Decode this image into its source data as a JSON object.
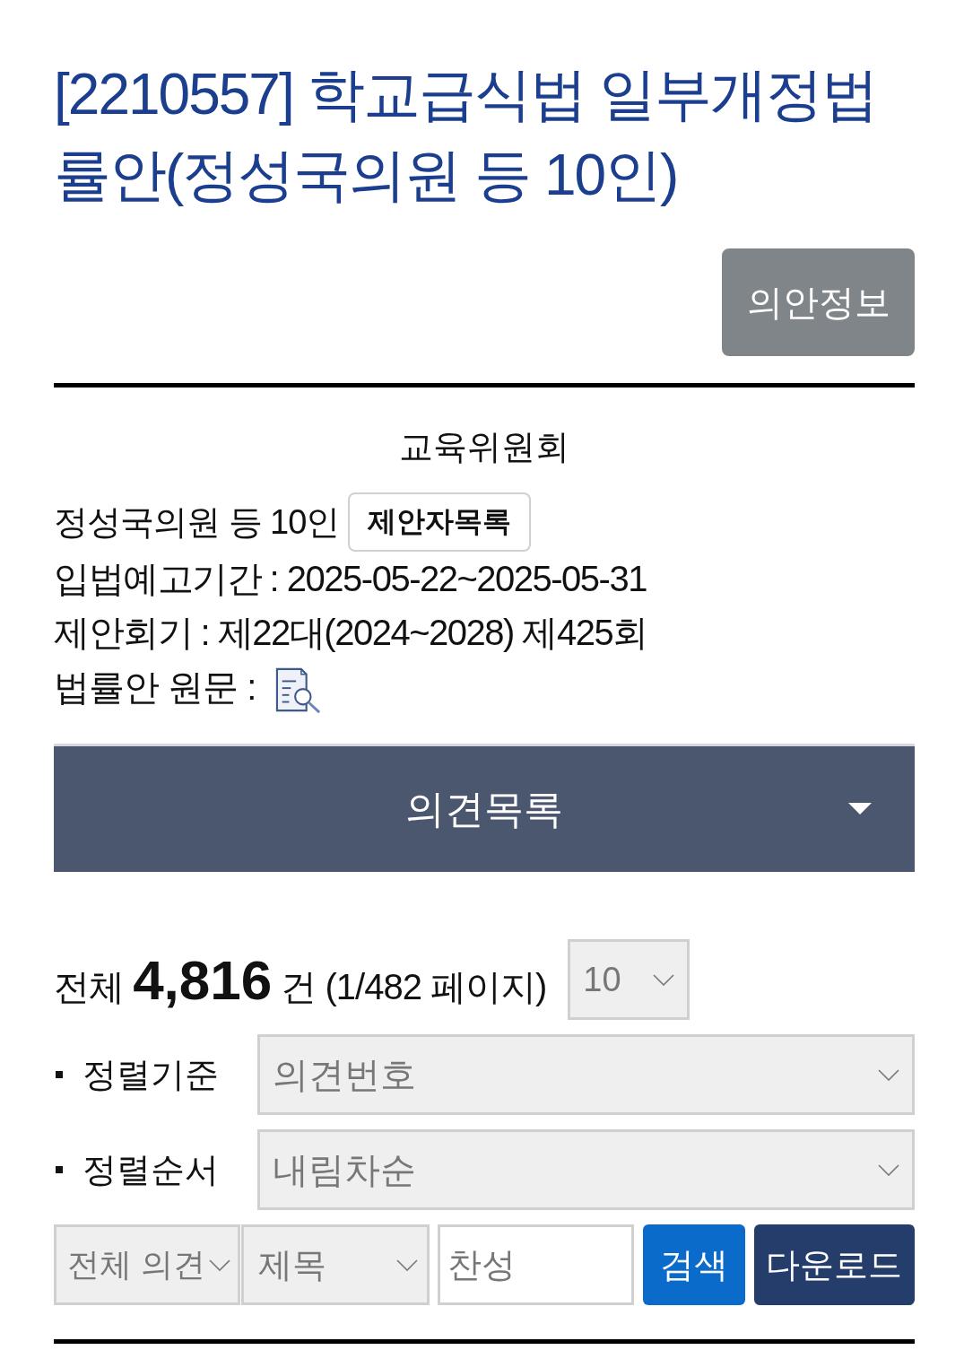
{
  "bill": {
    "title": "[2210557] 학교급식법 일부개정법률안(정성국의원 등 10인)",
    "info_button": "의안정보"
  },
  "details": {
    "committee": "교육위원회",
    "proposer": "정성국의원 등 10인",
    "proposer_list_button": "제안자목록",
    "lines": [
      "입법예고기간 : 2025-05-22~2025-05-31",
      "제안회기 : 제22대(2024~2028) 제425회"
    ],
    "original_text_label": "법률안 원문 :"
  },
  "opinion_panel": {
    "title": "의견목록"
  },
  "summary": {
    "text": "전체 **4,816** 건 (1/482 페이지)",
    "page_size": "10"
  },
  "sort_rows": [
    {
      "label": "정렬기준",
      "value": "의견번호"
    },
    {
      "label": "정렬순서",
      "value": "내림차순"
    }
  ],
  "search": {
    "scope": "전체 의견",
    "field": "제목",
    "query": "찬성",
    "buttons": [
      {
        "label": "검색",
        "kind": "search"
      },
      {
        "label": "다운로드",
        "kind": "download"
      }
    ]
  }
}
